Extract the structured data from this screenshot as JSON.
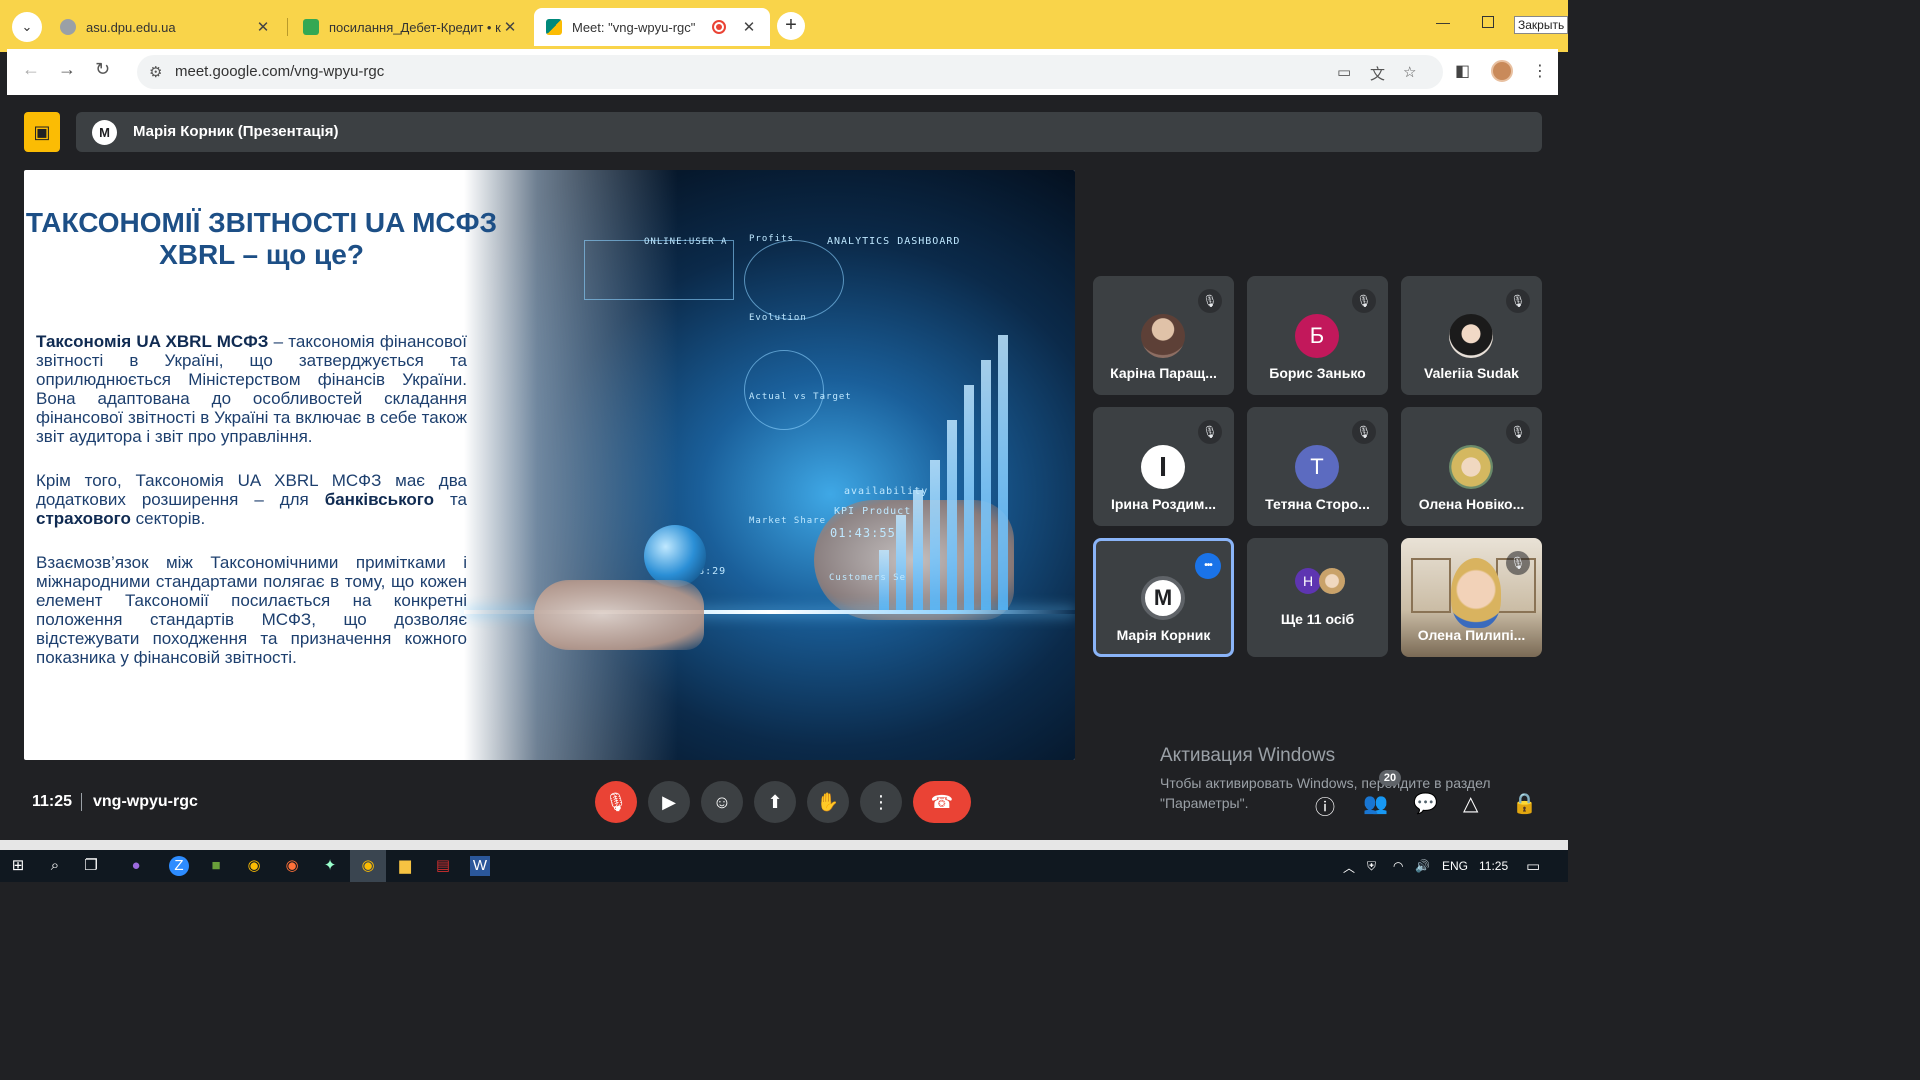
{
  "browser": {
    "tabs": [
      {
        "title": "asu.dpu.edu.ua",
        "fav_color": "#9aa0a6"
      },
      {
        "title": "посилання_Дебет-Кредит • ко",
        "fav_color": "#34a853"
      },
      {
        "title": "Meet: \"vng-wpyu-rgc\"",
        "fav_color": "#00897b",
        "recording": true
      }
    ],
    "new_tab_glyph": "+",
    "close_badge": "Закрыть",
    "url": "meet.google.com/vng-wpyu-rgc"
  },
  "meet": {
    "presenter_initial": "M",
    "presenter_label": "Марія Корник (Презентація)",
    "slide": {
      "title": "ТАКСОНОМІЇ ЗВІТНОСТІ UA МСФЗ XBRL – що це?",
      "p1_bold": "Таксономія UA XBRL МСФЗ",
      "p1_rest": " – таксономія фінансової звітності в Україні, що затверджується та оприлюднюється Міністерством фінансів України. Вона адаптована до особливостей складання фінансової звітності в Україні та включає в себе також звіт аудитора і звіт про управління.",
      "p2_a": "Крім того, Таксономія UA XBRL МСФЗ має два додаткових розширення – для ",
      "p2_b1": "банківського",
      "p2_c": " та ",
      "p2_b2": "страхового",
      "p2_d": " секторів.",
      "p3": "Взаємозв’язок між Таксономічними примітками і міжнародними стандартами полягає в тому, що кожен елемент Таксономії посилається на конкретні положення стандартів МСФЗ, що дозволяє відстежувати походження та призначення кожного показника у фінансовій звітності.",
      "holo_texts": [
        "ONLINE:USER A",
        "Profits",
        "ANALYTICS DASHBOARD",
        "Evolution",
        "Actual vs Target",
        "Market Share",
        "availability",
        "KPI Product",
        "01:43:55",
        "00:38:29",
        "Customers Se"
      ]
    },
    "participants": [
      {
        "name": "Каріна Паращ...",
        "initial": "",
        "color": "#8d6e63",
        "photo": true
      },
      {
        "name": "Борис Занько",
        "initial": "Б",
        "color": "#c2185b"
      },
      {
        "name": "Valeriia Sudak",
        "initial": "",
        "color": "#d7ccc8",
        "photo": true
      },
      {
        "name": "Ірина Роздим...",
        "initial": "I",
        "color": "#ffffff"
      },
      {
        "name": "Тетяна Сторо...",
        "initial": "T",
        "color": "#5c6bc0"
      },
      {
        "name": "Олена Новіко...",
        "initial": "",
        "color": "#b0bec5",
        "photo": true
      },
      {
        "name": "Марія Корник",
        "initial": "M",
        "color": "#ffffff",
        "speaking": true
      },
      {
        "name": "Ще 11 осіб",
        "initial": "Н",
        "color": "#5e35b1",
        "more": true
      },
      {
        "name": "Олена Пилипі...",
        "initial": "",
        "color": "#a1887f",
        "video": true
      }
    ],
    "time": "11:25",
    "meeting_code": "vng-wpyu-rgc",
    "people_count": "20",
    "watermark_title": "Активация Windows",
    "watermark_sub": "Чтобы активировать Windows, перейдите в раздел \"Параметры\"."
  },
  "taskbar": {
    "lang": "ENG",
    "clock": "11:25"
  },
  "icons": {
    "mic_off": "mic-off-icon",
    "camera": "camera-icon",
    "emoji": "emoji-icon",
    "present": "present-icon",
    "hand": "raise-hand-icon",
    "more": "more-icon",
    "leave": "leave-call-icon",
    "info": "info-icon",
    "people": "people-icon",
    "chat": "chat-icon",
    "activities": "activities-icon",
    "host": "host-controls-icon"
  }
}
